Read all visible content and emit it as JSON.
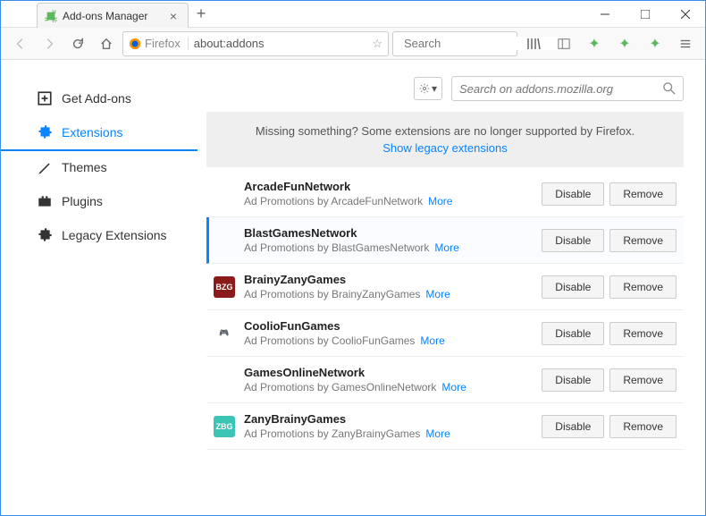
{
  "window": {
    "tab_title": "Add-ons Manager"
  },
  "toolbar": {
    "brand": "Firefox",
    "url": "about:addons",
    "search_placeholder": "Search"
  },
  "sidebar": {
    "items": [
      {
        "label": "Get Add-ons"
      },
      {
        "label": "Extensions"
      },
      {
        "label": "Themes"
      },
      {
        "label": "Plugins"
      },
      {
        "label": "Legacy Extensions"
      }
    ]
  },
  "main": {
    "addon_search_placeholder": "Search on addons.mozilla.org",
    "notice_text": "Missing something? Some extensions are no longer supported by Firefox.",
    "notice_link": "Show legacy extensions",
    "more_label": "More",
    "disable_label": "Disable",
    "remove_label": "Remove",
    "extensions": [
      {
        "name": "ArcadeFunNetwork",
        "desc": "Ad Promotions by ArcadeFunNetwork",
        "icon_bg": "transparent",
        "icon_text": ""
      },
      {
        "name": "BlastGamesNetwork",
        "desc": "Ad Promotions by BlastGamesNetwork",
        "icon_bg": "transparent",
        "icon_text": ""
      },
      {
        "name": "BrainyZanyGames",
        "desc": "Ad Promotions by BrainyZanyGames",
        "icon_bg": "#8b1a1a",
        "icon_text": "BZG"
      },
      {
        "name": "CoolioFunGames",
        "desc": "Ad Promotions by CoolioFunGames",
        "icon_bg": "transparent",
        "icon_text": "🎮",
        "icon_color": "#2aa0d8"
      },
      {
        "name": "GamesOnlineNetwork",
        "desc": "Ad Promotions by GamesOnlineNetwork",
        "icon_bg": "transparent",
        "icon_text": ""
      },
      {
        "name": "ZanyBrainyGames",
        "desc": "Ad Promotions by ZanyBrainyGames",
        "icon_bg": "#3cc4b4",
        "icon_text": "ZBG"
      }
    ],
    "selected_index": 1
  }
}
